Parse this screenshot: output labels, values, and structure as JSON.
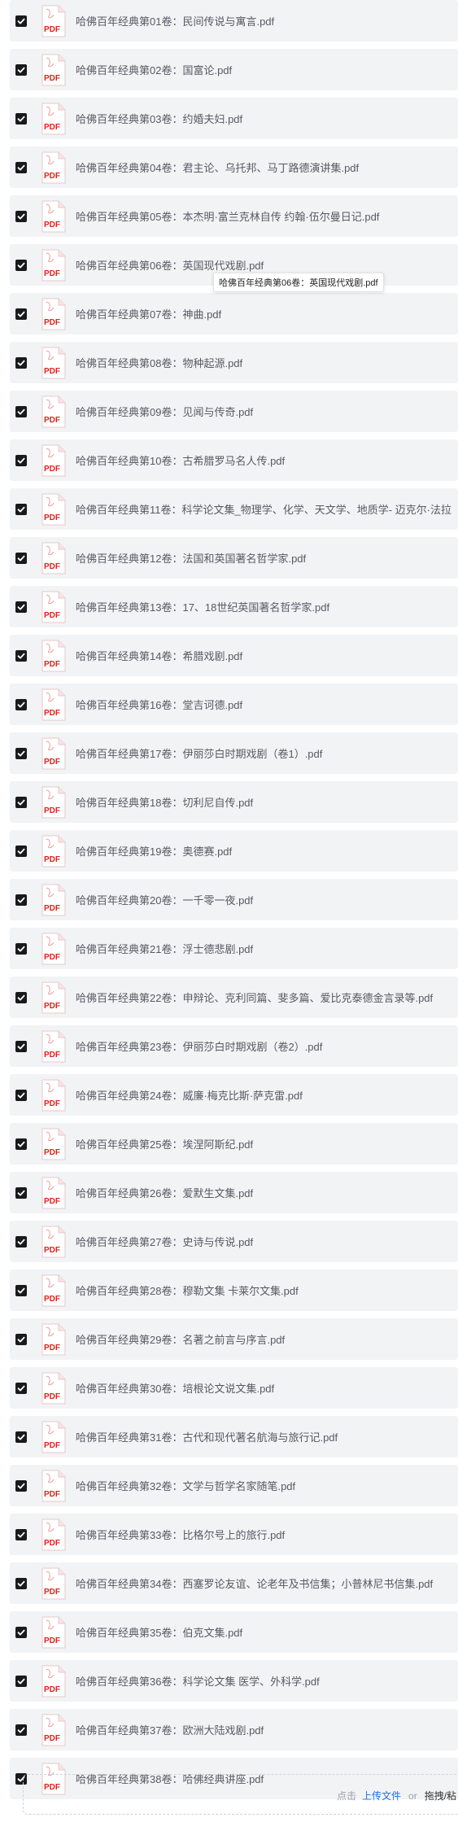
{
  "files": [
    {
      "name": "哈佛百年经典第01卷：民间传说与寓言.pdf"
    },
    {
      "name": "哈佛百年经典第02卷：国富论.pdf"
    },
    {
      "name": "哈佛百年经典第03卷：约婚夫妇.pdf"
    },
    {
      "name": "哈佛百年经典第04卷：君主论、乌托邦、马丁路德演讲集.pdf"
    },
    {
      "name": "哈佛百年经典第05卷：本杰明·富兰克林自传 约翰·伍尔曼日记.pdf"
    },
    {
      "name": "哈佛百年经典第06卷：英国现代戏剧.pdf"
    },
    {
      "name": "哈佛百年经典第07卷：神曲.pdf"
    },
    {
      "name": "哈佛百年经典第08卷：物种起源.pdf"
    },
    {
      "name": "哈佛百年经典第09卷：见闻与传奇.pdf"
    },
    {
      "name": "哈佛百年经典第10卷：古希腊罗马名人传.pdf"
    },
    {
      "name": "哈佛百年经典第11卷：科学论文集_物理学、化学、天文学、地质学- 迈克尔·法拉"
    },
    {
      "name": "哈佛百年经典第12卷：法国和英国著名哲学家.pdf"
    },
    {
      "name": "哈佛百年经典第13卷：17、18世纪英国著名哲学家.pdf"
    },
    {
      "name": "哈佛百年经典第14卷：希腊戏剧.pdf"
    },
    {
      "name": "哈佛百年经典第16卷：堂吉诃德.pdf"
    },
    {
      "name": "哈佛百年经典第17卷：伊丽莎白时期戏剧（卷1）.pdf"
    },
    {
      "name": "哈佛百年经典第18卷：切利尼自传.pdf"
    },
    {
      "name": "哈佛百年经典第19卷：奥德赛.pdf"
    },
    {
      "name": "哈佛百年经典第20卷：一千零一夜.pdf"
    },
    {
      "name": "哈佛百年经典第21卷：浮士德悲剧.pdf"
    },
    {
      "name": "哈佛百年经典第22卷：申辩论、克利同篇、斐多篇、爱比克泰德金言录等.pdf"
    },
    {
      "name": "哈佛百年经典第23卷：伊丽莎白时期戏剧（卷2）.pdf"
    },
    {
      "name": "哈佛百年经典第24卷：威廉·梅克比斯·萨克雷.pdf"
    },
    {
      "name": "哈佛百年经典第25卷：埃涅阿斯纪.pdf"
    },
    {
      "name": "哈佛百年经典第26卷：爱默生文集.pdf"
    },
    {
      "name": "哈佛百年经典第27卷：史诗与传说.pdf"
    },
    {
      "name": "哈佛百年经典第28卷：穆勒文集 卡莱尔文集.pdf"
    },
    {
      "name": "哈佛百年经典第29卷：名著之前言与序言.pdf"
    },
    {
      "name": "哈佛百年经典第30卷：培根论文说文集.pdf"
    },
    {
      "name": "哈佛百年经典第31卷：古代和现代著名航海与旅行记.pdf"
    },
    {
      "name": "哈佛百年经典第32卷：文学与哲学名家随笔.pdf"
    },
    {
      "name": "哈佛百年经典第33卷：比格尔号上的旅行.pdf"
    },
    {
      "name": "哈佛百年经典第34卷：西塞罗论友谊、论老年及书信集；小普林尼书信集.pdf"
    },
    {
      "name": "哈佛百年经典第35卷：伯克文集.pdf"
    },
    {
      "name": "哈佛百年经典第36卷：科学论文集 医学、外科学.pdf"
    },
    {
      "name": "哈佛百年经典第37卷：欧洲大陆戏剧.pdf"
    },
    {
      "name": "哈佛百年经典第38卷：哈佛经典讲座.pdf"
    }
  ],
  "icons": {
    "file": "pdf-file-icon",
    "checkbox": "checkmark-icon"
  },
  "pdf_badge_text": "PDF",
  "tooltip": {
    "text": "哈佛百年经典第06卷：英国现代戏剧.pdf"
  },
  "upload": {
    "hint": "点击",
    "link": "上传文件",
    "or": "or",
    "drag": "拖拽/粘"
  },
  "colors": {
    "accent": "#1a73e8",
    "pdf_red": "#e0201b",
    "row_bg": "#f2f3f5"
  }
}
